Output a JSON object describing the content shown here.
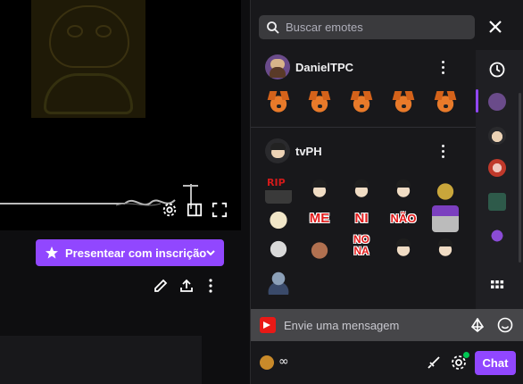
{
  "player": {
    "gift_button_label": "Presentear com inscrição"
  },
  "emote_picker": {
    "search_placeholder": "Buscar emotes",
    "sections": [
      {
        "name": "DanielTPC"
      },
      {
        "name": "tvPH"
      }
    ],
    "emote_texts": {
      "rip": "RIP",
      "me": "ME",
      "ni": "NI",
      "nao": "NÃO",
      "nona": "NO NA"
    }
  },
  "chat": {
    "message_placeholder": "Envie uma mensagem",
    "infinity_label": "∞",
    "send_button_label": "Chat"
  },
  "colors": {
    "accent": "#9147ff",
    "background": "#0e0e10",
    "panel": "#18181b",
    "input": "#464649"
  }
}
